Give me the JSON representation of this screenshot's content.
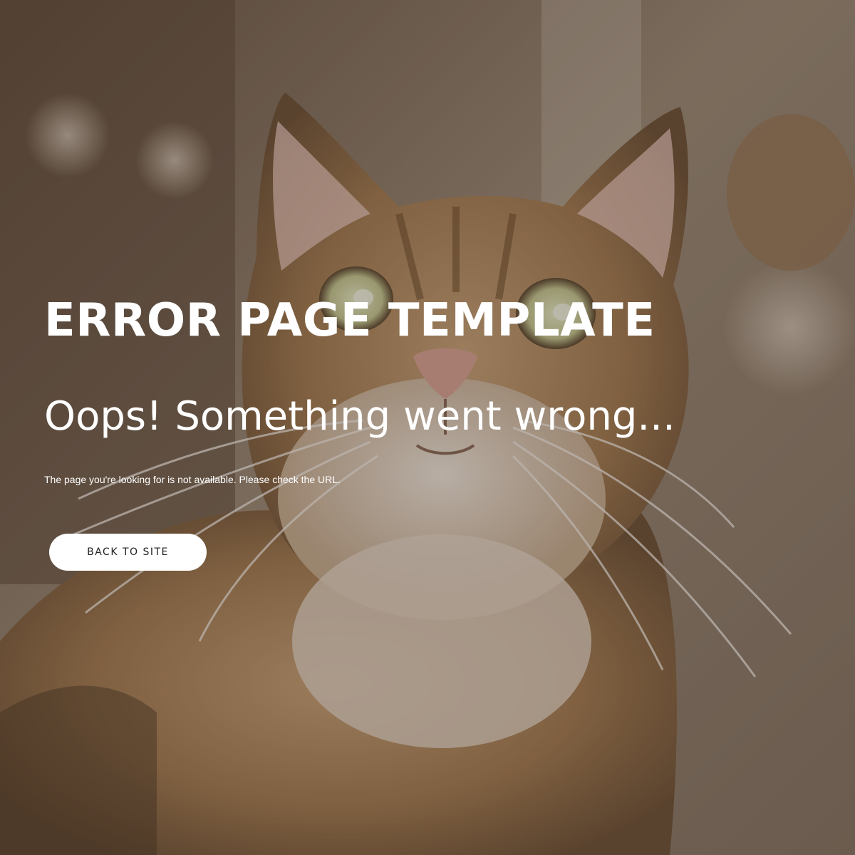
{
  "hero": {
    "background_image": "tabby-cat-photo",
    "overlay_color": "#281e16"
  },
  "content": {
    "title": "ERROR PAGE TEMPLATE",
    "subtitle": "Oops! Something went wrong...",
    "message": "The page you're looking for is not available. Please check the URL."
  },
  "button": {
    "label": "BACK TO SITE"
  },
  "colors": {
    "text": "#ffffff",
    "button_bg": "#ffffff",
    "button_text": "#222222"
  }
}
